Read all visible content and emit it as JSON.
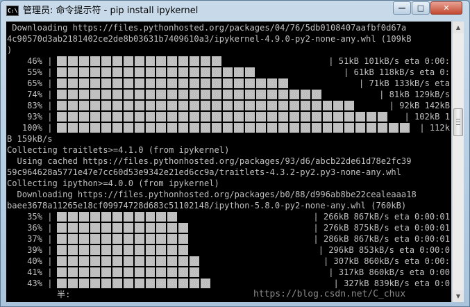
{
  "window": {
    "title": "管理员: 命令提示符 - pip  install ipykernel",
    "app_icon_text": "C:\\",
    "buttons": {
      "minimize": "—",
      "maximize": "□",
      "close": "✕"
    }
  },
  "colors": {
    "console_bg": "#000000",
    "console_fg": "#c0c0c0",
    "title_text": "#000000"
  },
  "console": {
    "lines": [
      {
        "text": " Downloading https://files.pythonhosted.org/packages/04/76/5db0108407aafbf0d67a"
      },
      {
        "text": "4c90570d3ab2181402ce2de8b03631b7409610a3/ipykernel-4.9.0-py2-none-any.whl (109kB"
      },
      {
        "text": ")"
      },
      {
        "text": "    46% |",
        "bar_fraction": 0.46,
        "suffix": "| 51kB 101kB/s eta 0:00:"
      },
      {
        "text": "    55% |",
        "bar_fraction": 0.55,
        "suffix": "| 61kB 118kB/s eta 0:"
      },
      {
        "text": "    65% |",
        "bar_fraction": 0.65,
        "suffix": "| 71kB 133kB/s eta"
      },
      {
        "text": "    74% |",
        "bar_fraction": 0.74,
        "suffix": "| 81kB 129kB/s"
      },
      {
        "text": "    83% |",
        "bar_fraction": 0.83,
        "suffix": "| 92kB 142kB"
      },
      {
        "text": "    93% |",
        "bar_fraction": 0.93,
        "suffix": "| 102kB 1"
      },
      {
        "text": "   100% |",
        "bar_fraction": 1.0,
        "suffix": "| 112k"
      },
      {
        "text": "B 159kB/s"
      },
      {
        "text": "Collecting traitlets>=4.1.0 (from ipykernel)"
      },
      {
        "text": "  Using cached https://files.pythonhosted.org/packages/93/d6/abcb22de61d78e2fc39"
      },
      {
        "text": "59c964628a5771e47e7cc60d53e9342e21ed6cc9a/traitlets-4.3.2-py2.py3-none-any.whl"
      },
      {
        "text": "Collecting ipython>=4.0.0 (from ipykernel)"
      },
      {
        "text": "  Downloading https://files.pythonhosted.org/packages/b0/88/d996ab8be22cealeaaa18"
      },
      {
        "text": "baee3678a11265e18cf09974728d683c51102148/ipython-5.8.0-py2-none-any.whl (760kB)"
      },
      {
        "text": "    35% |",
        "bar_fraction": 0.35,
        "suffix": "| 266kB 867kB/s eta 0:00:01"
      },
      {
        "text": "    36% |",
        "bar_fraction": 0.36,
        "suffix": "| 276kB 875kB/s eta 0:00:01"
      },
      {
        "text": "    37% |",
        "bar_fraction": 0.37,
        "suffix": "| 286kB 867kB/s eta 0:00:01"
      },
      {
        "text": "    39% |",
        "bar_fraction": 0.39,
        "suffix": "| 296kB 853kB/s eta 0:00:0"
      },
      {
        "text": "    40% |",
        "bar_fraction": 0.4,
        "suffix": "| 307kB 860kB/s eta 0:00:"
      },
      {
        "text": "    41% |",
        "bar_fraction": 0.41,
        "suffix": "| 317kB 860kB/s eta 0:00"
      },
      {
        "text": "    43% |",
        "bar_fraction": 0.43,
        "suffix": "| 327kB 839kB/s eta 0:0"
      }
    ],
    "ime_text": "半:"
  },
  "watermark": "https://blog.csdn.net/C_chux"
}
